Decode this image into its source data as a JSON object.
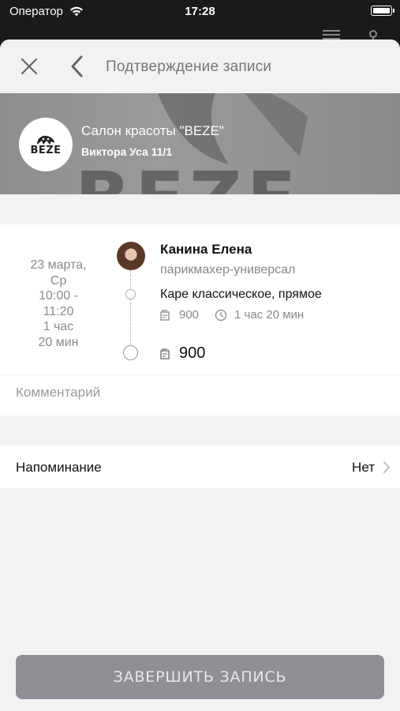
{
  "status_bar": {
    "carrier": "Оператор",
    "time": "17:28"
  },
  "nav": {
    "title": "Подтверждение записи",
    "close_icon": "close-icon",
    "back_icon": "chevron-left-icon"
  },
  "salon": {
    "name": "Салон красоты \"BEZE\"",
    "address": "Виктора Уса 11/1",
    "logo_text": "BEZE",
    "banner_text": "BEZE"
  },
  "booking": {
    "date_lines": [
      "23 марта,",
      "Ср",
      "10:00 -",
      "11:20",
      "1 час",
      "20 мин"
    ],
    "master_name": "Канина Елена",
    "master_role": "парикмахер-универсал",
    "service": "Каре классическое, прямое",
    "service_price": "900",
    "service_duration": "1 час 20 мин",
    "total": "900"
  },
  "comment": {
    "placeholder": "Комментарий"
  },
  "reminder": {
    "label": "Напоминание",
    "value": "Нет"
  },
  "finish_button": {
    "label": "ЗАВЕРШИТЬ ЗАПИСЬ"
  },
  "colors": {
    "button_bg": "#8e9096",
    "banner_bg": "#929292",
    "sheet_bg": "#f2f2f2"
  }
}
